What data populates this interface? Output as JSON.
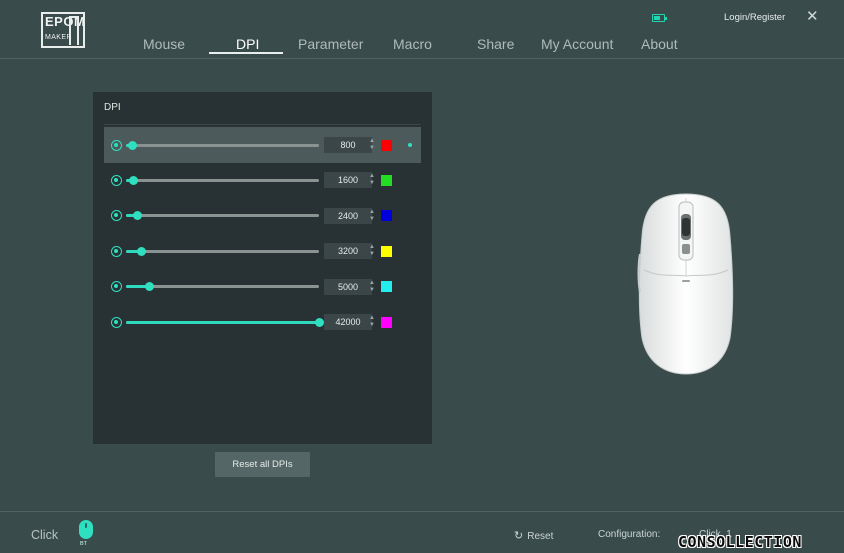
{
  "header": {
    "logo_line1": "EPOM",
    "logo_line2": "MAKER",
    "login_label": "Login/Register",
    "nav": [
      {
        "label": "Mouse",
        "active": false
      },
      {
        "label": "DPI",
        "active": true
      },
      {
        "label": "Parameter",
        "active": false
      },
      {
        "label": "Macro",
        "active": false
      },
      {
        "label": "Share",
        "active": false
      },
      {
        "label": "My Account",
        "active": false
      },
      {
        "label": "About",
        "active": false
      }
    ],
    "close_glyph": "✕"
  },
  "dpi_panel": {
    "title": "DPI",
    "max_dpi": 42000,
    "levels": [
      {
        "value": "800",
        "color": "#ff0000",
        "selected": true
      },
      {
        "value": "1600",
        "color": "#22dd22",
        "selected": false
      },
      {
        "value": "2400",
        "color": "#0000dd",
        "selected": false
      },
      {
        "value": "3200",
        "color": "#ffff00",
        "selected": false
      },
      {
        "value": "5000",
        "color": "#22eeee",
        "selected": false
      },
      {
        "value": "42000",
        "color": "#ff00ff",
        "selected": false
      }
    ],
    "reset_all_label": "Reset all DPIs"
  },
  "footer": {
    "click_label": "Click",
    "bt_label": "BT",
    "reset_label": "Reset",
    "configuration_label": "Configuration:",
    "configuration_value": "Click_1",
    "watermark": "CONSOLLECTION"
  },
  "colors": {
    "accent": "#2fe0c0",
    "background": "#3a4b4c",
    "panel": "#283234"
  }
}
